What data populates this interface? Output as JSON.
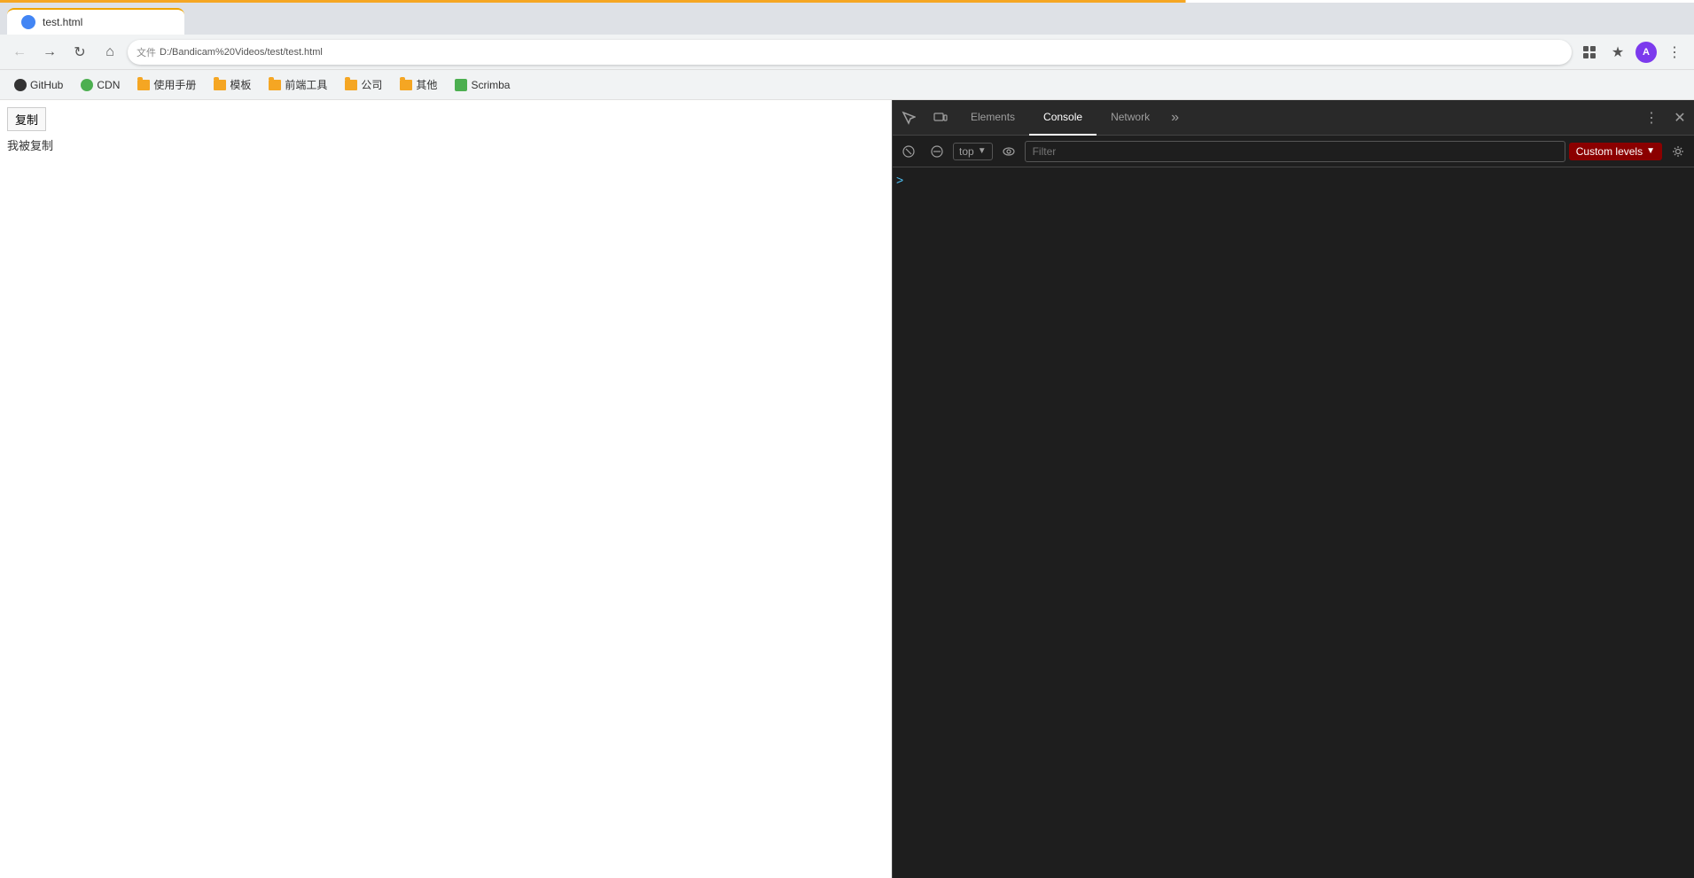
{
  "browser": {
    "tab_title": "test.html",
    "address": "D:/Bandicam%20Videos/test/test.html",
    "address_prefix": "文件"
  },
  "bookmarks": [
    {
      "id": "github",
      "label": "GitHub",
      "type": "github"
    },
    {
      "id": "cdn",
      "label": "CDN",
      "type": "cdn"
    },
    {
      "id": "manual",
      "label": "使用手册",
      "type": "folder"
    },
    {
      "id": "template",
      "label": "模板",
      "type": "folder"
    },
    {
      "id": "frontend",
      "label": "前端工具",
      "type": "folder"
    },
    {
      "id": "company",
      "label": "公司",
      "type": "folder"
    },
    {
      "id": "other",
      "label": "其他",
      "type": "folder"
    },
    {
      "id": "scrimba",
      "label": "Scrimba",
      "type": "scrimba"
    }
  ],
  "page": {
    "button_label": "复制",
    "copied_text": "我被复制"
  },
  "devtools": {
    "tabs": [
      {
        "id": "elements",
        "label": "Elements",
        "active": false
      },
      {
        "id": "console",
        "label": "Console",
        "active": true
      },
      {
        "id": "network",
        "label": "Network",
        "active": false
      }
    ],
    "more_label": "»",
    "console": {
      "context": "top",
      "filter_placeholder": "Filter",
      "custom_levels_label": "Custom levels",
      "caret": ">"
    }
  }
}
